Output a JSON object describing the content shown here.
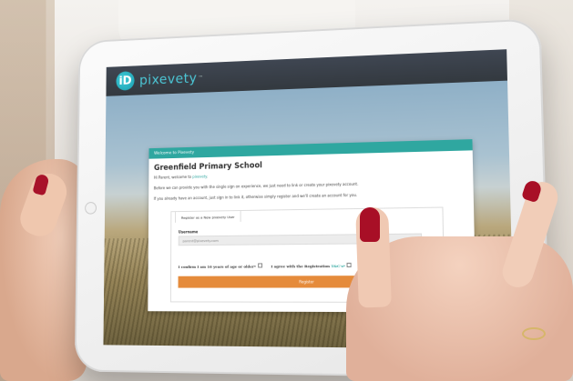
{
  "app": {
    "logo_mark": "iD",
    "logo_text": "pixevety",
    "logo_tm": "™"
  },
  "card": {
    "header": "Welcome to Pixevety",
    "school_name": "Greenfield Primary School",
    "greeting_prefix": "Hi Parent, welcome to ",
    "greeting_link": "pixevety",
    "greeting_suffix": ".",
    "intro_line": "Before we can provide you with the single sign on experience, we just need to link or create your pixevety account.",
    "account_line": "If you already have an account, just sign in to link it, otherwise simply register and we'll create an account for you."
  },
  "form": {
    "tab_label": "Register as a New pixevety User",
    "username_label": "Username",
    "username_value": "parent@pixevety.com",
    "age_check_label": "I confirm I am 16 years of age or older*",
    "terms_check_prefix": "I agree with the Registration ",
    "terms_check_link": "T&C's*",
    "register_label": "Register"
  },
  "colors": {
    "teal": "#2fa7a0",
    "orange": "#e58b3b",
    "topbar": "#3b4350",
    "nail": "#a80f26"
  }
}
